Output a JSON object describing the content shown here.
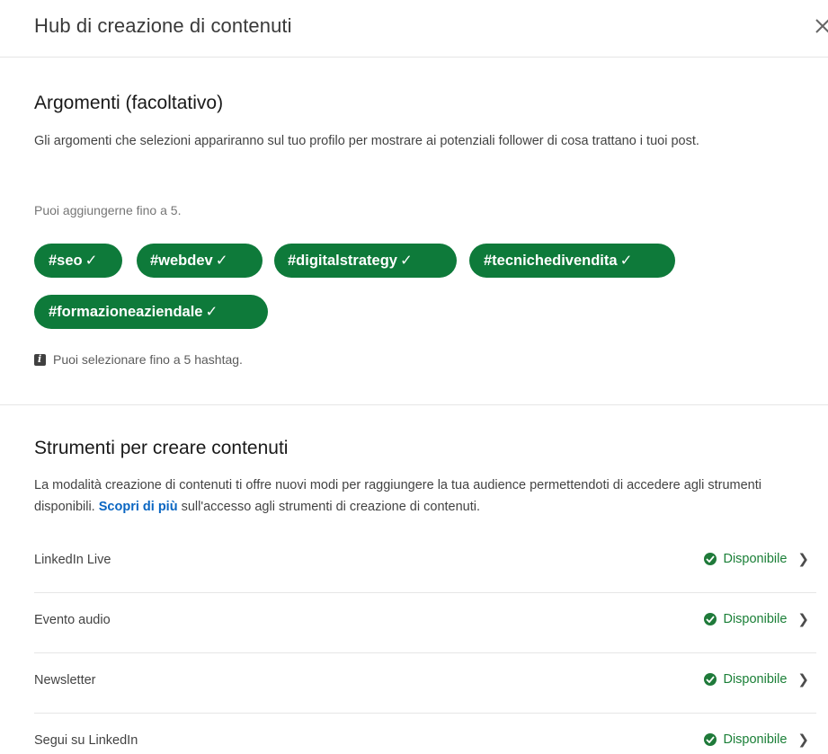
{
  "header": {
    "title": "Hub di creazione di contenuti",
    "close_icon": "close-icon"
  },
  "topics": {
    "title": "Argomenti (facoltativo)",
    "description": "Gli argomenti che selezioni appariranno sul tuo profilo per mostrare ai potenziali follower di cosa trattano i tuoi post.",
    "limit_hint": "Puoi aggiungerne fino a 5.",
    "tags": [
      {
        "label": "#seo",
        "check": "✓"
      },
      {
        "label": "#webdev",
        "check": "✓"
      },
      {
        "label": "#digitalstrategy",
        "check": "✓"
      },
      {
        "label": "#tecnichedivendita",
        "check": "✓"
      },
      {
        "label": "#formazioneaziendale",
        "check": "✓"
      }
    ],
    "info_note": "Puoi selezionare fino a 5 hashtag.",
    "tag_color": "#0e7a3a"
  },
  "tools": {
    "title": "Strumenti per creare contenuti",
    "description_before": "La modalità creazione di contenuti ti offre nuovi modi per raggiungere la tua audience permettendoti di accedere agli strumenti disponibili.",
    "link_text": "Scopri di più",
    "description_after": "sull'accesso agli strumenti di creazione di contenuti.",
    "rows": [
      {
        "name": "LinkedIn Live",
        "status": "Disponibile"
      },
      {
        "name": "Evento audio",
        "status": "Disponibile"
      },
      {
        "name": "Newsletter",
        "status": "Disponibile"
      },
      {
        "name": "Segui su LinkedIn",
        "status": "Disponibile"
      }
    ],
    "status_color": "#1a7f37"
  }
}
